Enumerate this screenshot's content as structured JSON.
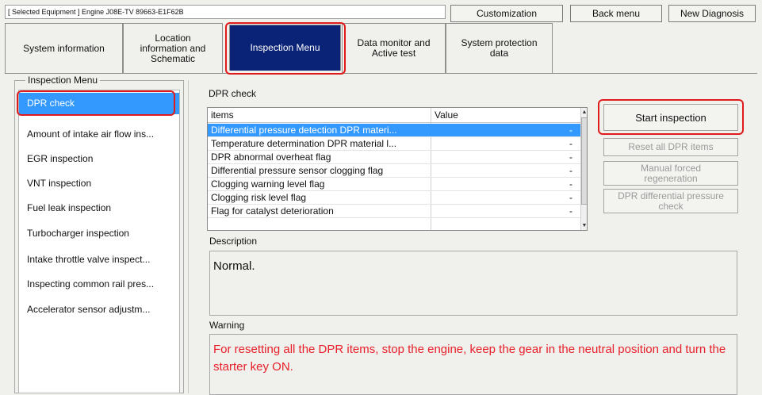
{
  "header": {
    "equipment": "[ Selected Equipment ] Engine J08E-TV 89663-E1F62B",
    "buttons": {
      "customization": "Customization",
      "back_menu": "Back menu",
      "new_diagnosis": "New Diagnosis"
    }
  },
  "tabs": [
    {
      "label": "System information"
    },
    {
      "label": "Location\ninformation and\nSchematic"
    },
    {
      "label": "Inspection Menu"
    },
    {
      "label": "Data monitor and\nActive test"
    },
    {
      "label": "System protection\ndata"
    }
  ],
  "sidebar": {
    "title": "Inspection Menu",
    "items": [
      "DPR check",
      "Amount of intake air flow ins...",
      "EGR inspection",
      "VNT inspection",
      "Fuel leak inspection",
      "Turbocharger inspection",
      "Intake throttle valve inspect...",
      "Inspecting common rail pres...",
      "Accelerator sensor adjustm..."
    ]
  },
  "main": {
    "section_title": "DPR check",
    "table": {
      "columns": [
        "items",
        "Value"
      ],
      "rows": [
        {
          "item": "Differential pressure detection DPR materi...",
          "value": "-"
        },
        {
          "item": "Temperature determination DPR material l...",
          "value": "-"
        },
        {
          "item": "DPR abnormal overheat flag",
          "value": "-"
        },
        {
          "item": "Differential pressure sensor clogging flag",
          "value": "-"
        },
        {
          "item": "Clogging warning level flag",
          "value": "-"
        },
        {
          "item": "Clogging risk level flag",
          "value": "-"
        },
        {
          "item": "Flag for catalyst deterioration",
          "value": "-"
        }
      ]
    },
    "buttons": {
      "start_inspection": "Start inspection",
      "reset_all": "Reset all DPR items",
      "manual_regen": "Manual forced\nregeneration",
      "diff_pressure_check": "DPR differential pressure\ncheck"
    },
    "description_label": "Description",
    "description_text": "Normal.",
    "warning_label": "Warning",
    "warning_text": "For resetting all the DPR items, stop the engine, keep the gear in the neutral position and turn the starter key ON."
  },
  "colors": {
    "active_tab": "#0a2377",
    "selection": "#3399ff",
    "highlight": "#e01b1b",
    "warning": "#e8202a"
  }
}
